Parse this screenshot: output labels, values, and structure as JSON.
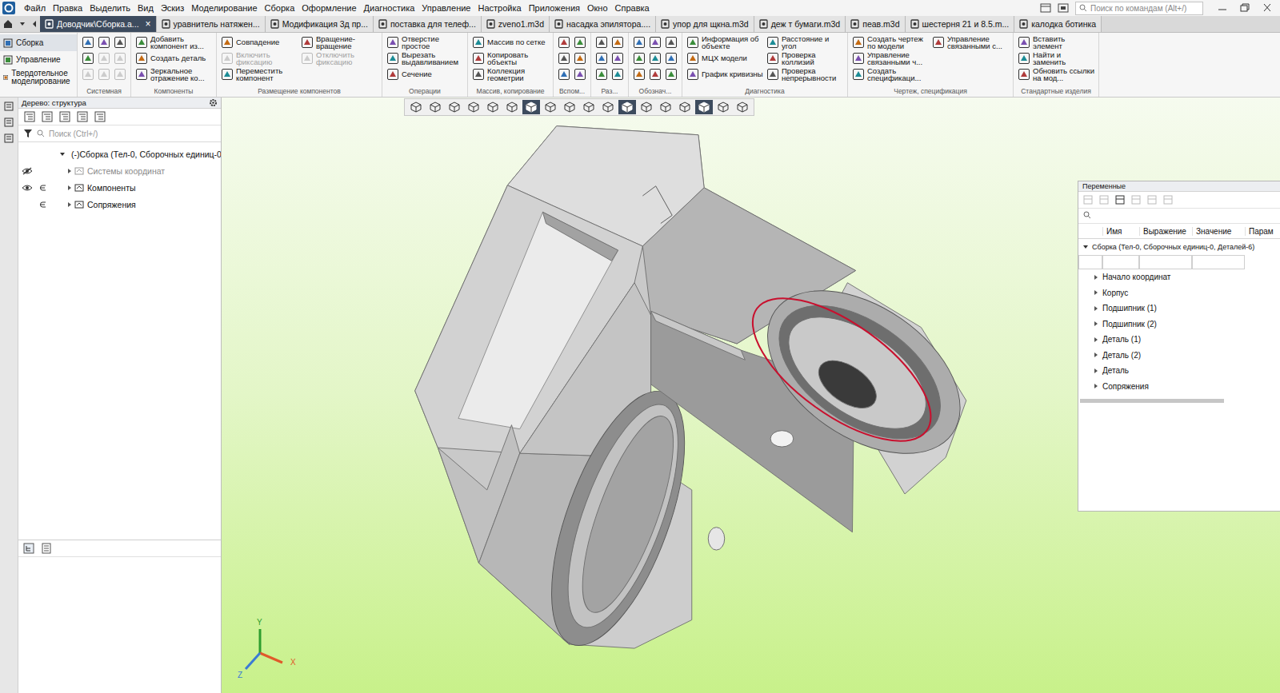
{
  "window": {
    "search": {
      "placeholder": "Поиск по командам (Alt+/)"
    }
  },
  "menu": [
    "Файл",
    "Правка",
    "Выделить",
    "Вид",
    "Эскиз",
    "Моделирование",
    "Сборка",
    "Оформление",
    "Диагностика",
    "Управление",
    "Настройка",
    "Приложения",
    "Окно",
    "Справка"
  ],
  "doc_tabs": {
    "close": "×",
    "items": [
      {
        "label": "Доводчик\\Сборка.а...",
        "selected": true
      },
      {
        "label": "уравнитель натяжен...",
        "selected": false
      },
      {
        "label": "Модификация 3д пр...",
        "selected": false
      },
      {
        "label": "поставка для телеф...",
        "selected": false
      },
      {
        "label": "zveno1.m3d",
        "selected": false
      },
      {
        "label": "насадка эпилятора....",
        "selected": false
      },
      {
        "label": "упор для щкна.m3d",
        "selected": false
      },
      {
        "label": "деж т бумаги.m3d",
        "selected": false
      },
      {
        "label": "пеав.m3d",
        "selected": false
      },
      {
        "label": "шестерня 21 и 8.5.m...",
        "selected": false
      },
      {
        "label": "калодка ботинка",
        "selected": false
      }
    ]
  },
  "ribbon": {
    "modes": [
      {
        "label": "Сборка",
        "selected": true
      },
      {
        "label": "Управление",
        "selected": false
      },
      {
        "label": "Твердотельное моделирование",
        "selected": false
      }
    ],
    "groups": [
      {
        "label": "Системная",
        "buttons": [
          {
            "kind": "icon",
            "disabled": false
          },
          {
            "kind": "icon",
            "disabled": false
          },
          {
            "kind": "icon",
            "disabled": true
          },
          {
            "kind": "icon",
            "disabled": false
          },
          {
            "kind": "icon",
            "disabled": true
          },
          {
            "kind": "icon",
            "disabled": true
          },
          {
            "kind": "icon",
            "disabled": false
          },
          {
            "kind": "icon",
            "disabled": true
          },
          {
            "kind": "icon",
            "disabled": true
          }
        ]
      },
      {
        "label": "Компоненты",
        "buttons": [
          {
            "kind": "text",
            "label": "Добавить компонент из...",
            "disabled": false
          },
          {
            "kind": "text",
            "label": "Создать деталь",
            "disabled": false
          },
          {
            "kind": "text",
            "label": "Зеркальное отражение ко...",
            "disabled": false
          }
        ]
      },
      {
        "label": "Размещение компонентов",
        "buttons": [
          {
            "kind": "text",
            "label": "Совпадение",
            "disabled": false
          },
          {
            "kind": "text",
            "label": "Включить фиксацию",
            "disabled": true
          },
          {
            "kind": "text",
            "label": "Переместить компонент",
            "disabled": false
          },
          {
            "kind": "text",
            "label": "Вращение-вращение",
            "disabled": false
          },
          {
            "kind": "text",
            "label": "Отключить фиксацию",
            "disabled": true
          }
        ]
      },
      {
        "label": "Операции",
        "buttons": [
          {
            "kind": "text",
            "label": "Отверстие простое",
            "disabled": false
          },
          {
            "kind": "text",
            "label": "Вырезать выдавливанием",
            "disabled": false
          },
          {
            "kind": "text",
            "label": "Сечение",
            "disabled": false
          }
        ]
      },
      {
        "label": "Массив, копирование",
        "buttons": [
          {
            "kind": "text",
            "label": "Массив по сетке",
            "disabled": false
          },
          {
            "kind": "text",
            "label": "Копировать объекты",
            "disabled": false
          },
          {
            "kind": "text",
            "label": "Коллекция геометрии",
            "disabled": false
          }
        ]
      },
      {
        "label": "Вспом...",
        "buttons": [
          {
            "kind": "icon",
            "disabled": false
          },
          {
            "kind": "icon",
            "disabled": false
          },
          {
            "kind": "icon",
            "disabled": false
          },
          {
            "kind": "icon",
            "disabled": false
          },
          {
            "kind": "icon",
            "disabled": false
          },
          {
            "kind": "icon",
            "disabled": false
          }
        ]
      },
      {
        "label": "Раз...",
        "buttons": [
          {
            "kind": "icon",
            "disabled": false
          },
          {
            "kind": "icon",
            "disabled": false
          },
          {
            "kind": "icon",
            "disabled": false
          },
          {
            "kind": "icon",
            "disabled": false
          },
          {
            "kind": "icon",
            "disabled": false
          },
          {
            "kind": "icon",
            "disabled": false
          }
        ]
      },
      {
        "label": "Обознач...",
        "buttons": [
          {
            "kind": "icon",
            "disabled": false
          },
          {
            "kind": "icon",
            "disabled": false
          },
          {
            "kind": "icon",
            "disabled": false
          },
          {
            "kind": "icon",
            "disabled": false
          },
          {
            "kind": "icon",
            "disabled": false
          },
          {
            "kind": "icon",
            "disabled": false
          },
          {
            "kind": "icon",
            "disabled": false
          },
          {
            "kind": "icon",
            "disabled": false
          },
          {
            "kind": "icon",
            "disabled": false
          }
        ]
      },
      {
        "label": "Диагностика",
        "buttons": [
          {
            "kind": "text",
            "label": "Информация об объекте",
            "disabled": false
          },
          {
            "kind": "text",
            "label": "МЦХ модели",
            "disabled": false
          },
          {
            "kind": "text",
            "label": "График кривизны",
            "disabled": false
          },
          {
            "kind": "text",
            "label": "Расстояние и угол",
            "disabled": false
          },
          {
            "kind": "text",
            "label": "Проверка коллизий",
            "disabled": false
          },
          {
            "kind": "text",
            "label": "Проверка непрерывности",
            "disabled": false
          }
        ]
      },
      {
        "label": "Чертеж, спецификация",
        "buttons": [
          {
            "kind": "text",
            "label": "Создать чертеж по модели",
            "disabled": false
          },
          {
            "kind": "text",
            "label": "Управление связанными ч...",
            "disabled": false
          },
          {
            "kind": "text",
            "label": "Создать спецификаци...",
            "disabled": false
          },
          {
            "kind": "text",
            "label": "Управление связанными с...",
            "disabled": false
          }
        ]
      },
      {
        "label": "Стандартные изделия",
        "buttons": [
          {
            "kind": "text",
            "label": "Вставить элемент",
            "disabled": false
          },
          {
            "kind": "text",
            "label": "Найти и заменить",
            "disabled": false
          },
          {
            "kind": "text",
            "label": "Обновить ссылки на мод...",
            "disabled": false
          }
        ]
      }
    ]
  },
  "tree": {
    "title": "Дерево: структура",
    "search_placeholder": "Поиск (Ctrl+/)",
    "items": [
      {
        "label": "(-)Сборка (Тел-0, Сборочных единиц-0",
        "level": 0,
        "expanded": true,
        "greyed": false,
        "eye": "none",
        "included": false
      },
      {
        "label": "Системы координат",
        "level": 1,
        "expanded": false,
        "greyed": true,
        "eye": "hidden",
        "included": false
      },
      {
        "label": "Компоненты",
        "level": 1,
        "expanded": false,
        "greyed": false,
        "eye": "shown",
        "included": true
      },
      {
        "label": "Сопряжения",
        "level": 1,
        "expanded": false,
        "greyed": false,
        "eye": "none",
        "included": true
      }
    ]
  },
  "view_toolbar": {
    "buttons": [
      {
        "pressed": false
      },
      {
        "pressed": false
      },
      {
        "pressed": false
      },
      {
        "pressed": false
      },
      {
        "pressed": false
      },
      {
        "pressed": false
      },
      {
        "pressed": true
      },
      {
        "pressed": false
      },
      {
        "pressed": false
      },
      {
        "pressed": false
      },
      {
        "pressed": false
      },
      {
        "pressed": true
      },
      {
        "pressed": false
      },
      {
        "pressed": false
      },
      {
        "pressed": false
      },
      {
        "pressed": true
      },
      {
        "pressed": false
      },
      {
        "pressed": false
      }
    ]
  },
  "triad": {
    "x": "X",
    "y": "Y",
    "z": "Z"
  },
  "variables": {
    "title": "Переменные",
    "columns": [
      "Имя",
      "Выражение",
      "Значение",
      "Парам"
    ],
    "root": {
      "label": "Сборка (Тел-0, Сборочных единиц-0, Деталей-6)",
      "expanded": true
    },
    "rows": [
      {
        "label": "Начало координат",
        "expanded": false
      },
      {
        "label": "Корпус",
        "expanded": false
      },
      {
        "label": "Подшипник (1)",
        "expanded": false
      },
      {
        "label": "Подшипник (2)",
        "expanded": false
      },
      {
        "label": "Деталь (1)",
        "expanded": false
      },
      {
        "label": "Деталь (2)",
        "expanded": false
      },
      {
        "label": "Деталь",
        "expanded": false
      },
      {
        "label": "Сопряжения",
        "expanded": false
      }
    ]
  }
}
